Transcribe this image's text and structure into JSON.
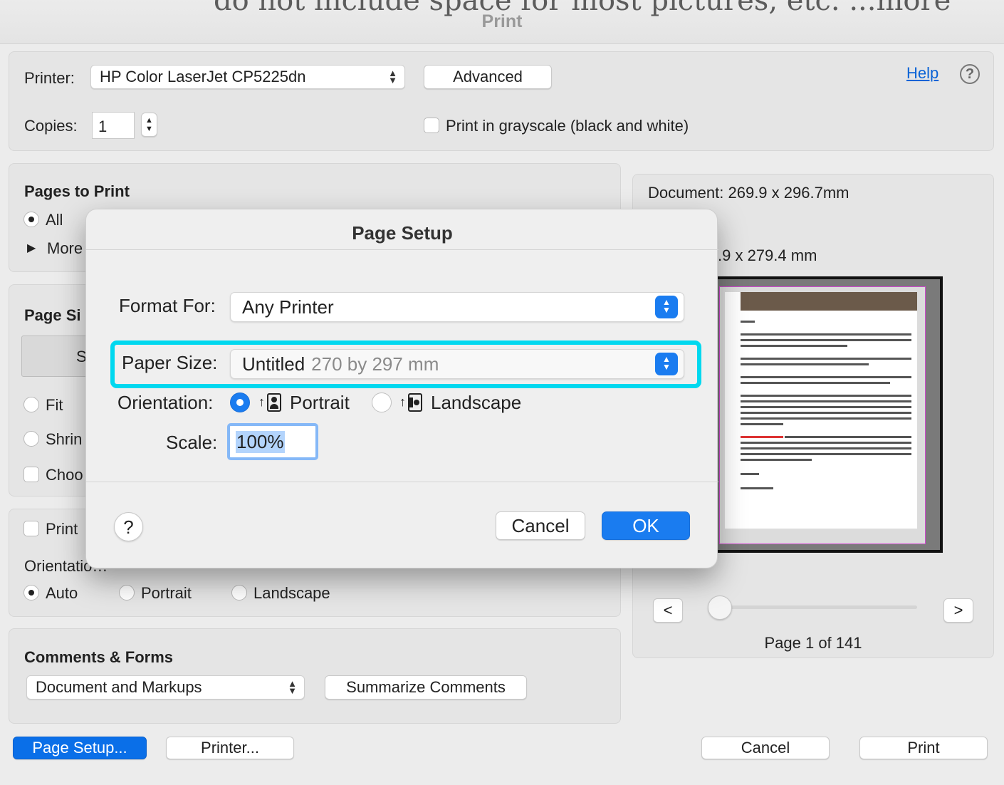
{
  "window": {
    "title": "Print",
    "background_text": "do not include space for most pictures, etc. ...more"
  },
  "top": {
    "printer_label": "Printer:",
    "printer_value": "HP Color LaserJet CP5225dn",
    "advanced_label": "Advanced",
    "help_label": "Help",
    "copies_label": "Copies:",
    "copies_value": "1",
    "grayscale_label": "Print in grayscale (black and white)"
  },
  "pages": {
    "heading": "Pages to Print",
    "all_label": "All",
    "more_label": "More"
  },
  "page_sizing": {
    "heading": "Page Si",
    "tab_partial": "S",
    "fit_label": "Fit",
    "shrink_label": "Shrin",
    "choose_label": "Choo"
  },
  "orientation_panel": {
    "print_label": "Print",
    "heading": "Orientatio…",
    "auto_label": "Auto",
    "portrait_label": "Portrait",
    "landscape_label": "Landscape"
  },
  "comments": {
    "heading": "Comments & Forms",
    "select_value": "Document and Markups",
    "summarize_label": "Summarize Comments"
  },
  "preview": {
    "document_size": "Document: 269.9 x 296.7mm",
    "paper_size_partial": ".9 x 279.4 mm",
    "prev_label": "<",
    "next_label": ">",
    "page_status": "Page 1 of 141",
    "slider_position": 0
  },
  "bottom": {
    "page_setup_label": "Page Setup...",
    "printer_label": "Printer...",
    "cancel_label": "Cancel",
    "print_label": "Print"
  },
  "page_setup_dialog": {
    "title": "Page Setup",
    "format_for_label": "Format For:",
    "format_for_value": "Any Printer",
    "paper_size_label": "Paper Size:",
    "paper_size_name": "Untitled",
    "paper_size_dims": "270 by 297 mm",
    "orientation_label": "Orientation:",
    "portrait_label": "Portrait",
    "landscape_label": "Landscape",
    "orientation_selected": "Portrait",
    "scale_label": "Scale:",
    "scale_value": "100%",
    "help_label": "?",
    "cancel_label": "Cancel",
    "ok_label": "OK"
  },
  "colors": {
    "accent": "#0a6fe8",
    "highlight": "#00d8ef",
    "ok_button": "#1a7cf0"
  }
}
